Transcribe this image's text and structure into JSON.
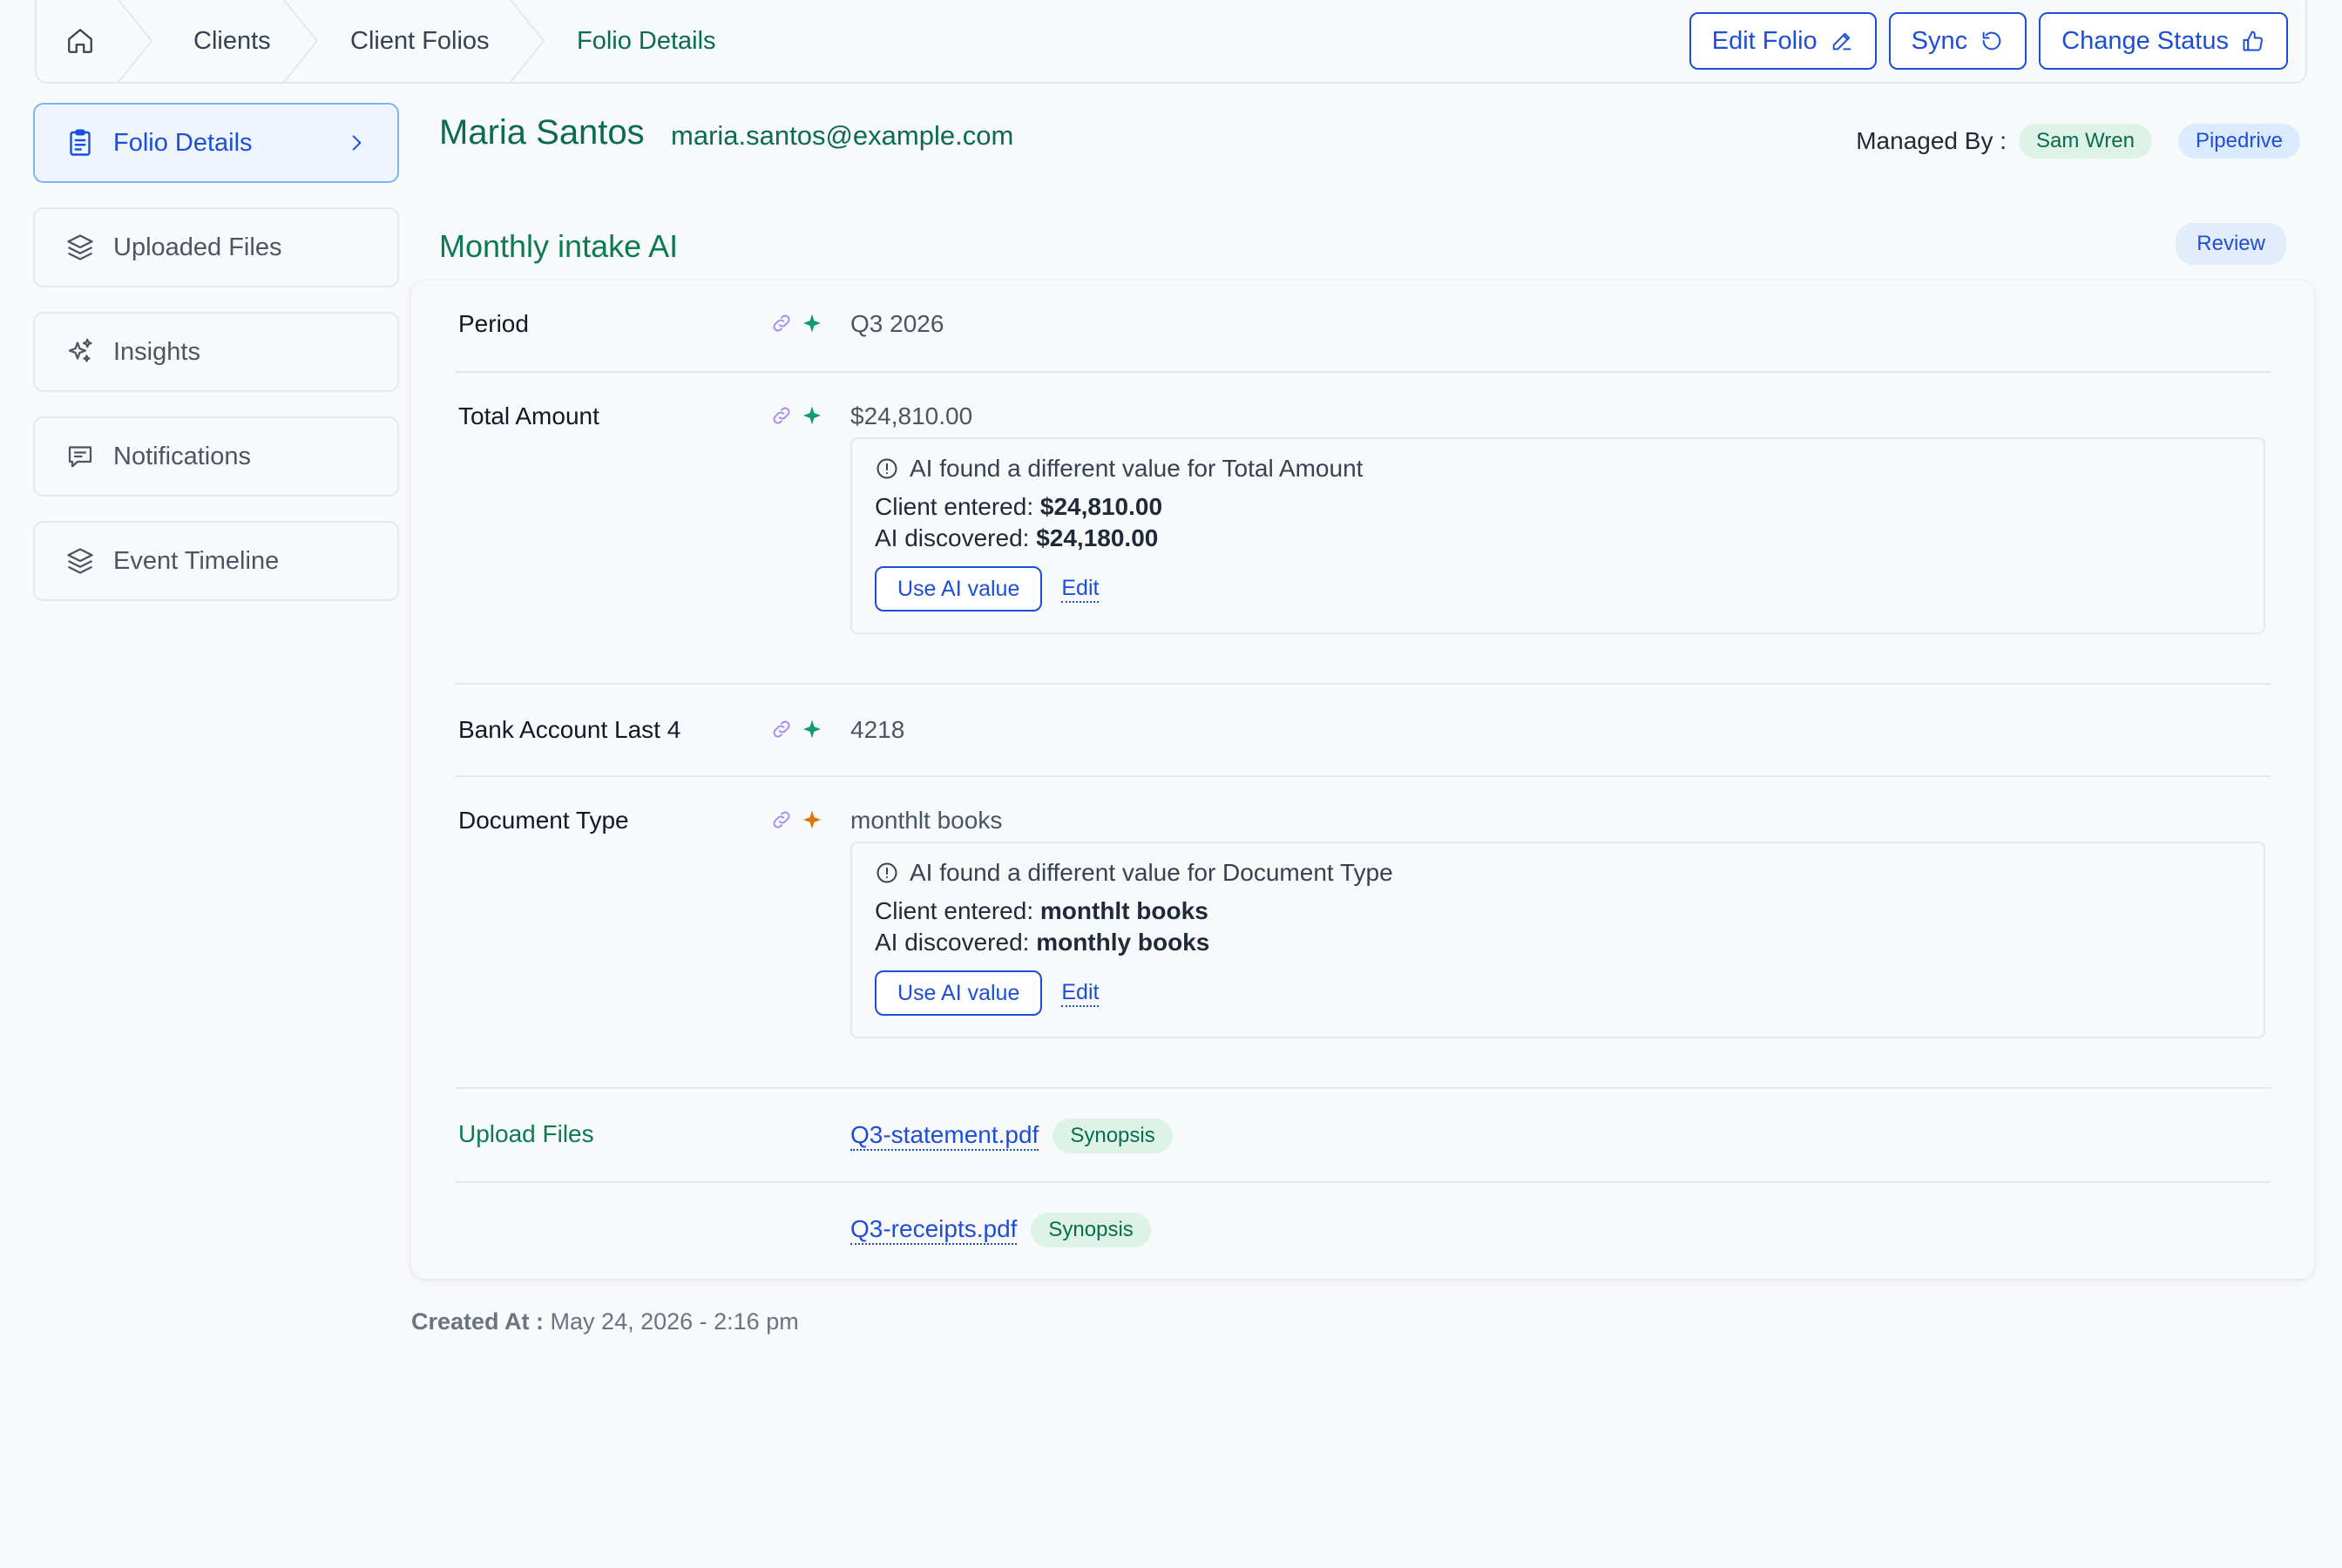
{
  "breadcrumb": {
    "home_icon": "home-icon",
    "items": [
      "Clients",
      "Client Folios",
      "Folio Details"
    ]
  },
  "toolbar": {
    "edit_folio": "Edit Folio",
    "sync": "Sync",
    "change_status": "Change Status"
  },
  "sidebar": {
    "items": [
      {
        "label": "Folio Details",
        "icon": "clipboard-icon",
        "active": true
      },
      {
        "label": "Uploaded Files",
        "icon": "layers-icon"
      },
      {
        "label": "Insights",
        "icon": "sparkles-icon"
      },
      {
        "label": "Notifications",
        "icon": "message-icon"
      },
      {
        "label": "Event Timeline",
        "icon": "layers-icon"
      }
    ]
  },
  "client": {
    "name": "Maria Santos",
    "email": "maria.santos@example.com",
    "managed_by_label": "Managed By :",
    "manager": "Sam Wren",
    "source": "Pipedrive"
  },
  "section": {
    "title": "Monthly intake AI",
    "status": "Review"
  },
  "fields": [
    {
      "label": "Period",
      "value": "Q3 2026",
      "sparkle_color": "#0f9d6b"
    },
    {
      "label": "Total Amount",
      "value": "$24,810.00",
      "sparkle_color": "#0f9d6b",
      "ai": {
        "heading": "AI found a different value for Total Amount",
        "client_label": "Client entered:",
        "client_value": "$24,810.00",
        "ai_label": "AI discovered:",
        "ai_value": "$24,180.00",
        "use_button": "Use AI value",
        "edit_link": "Edit"
      }
    },
    {
      "label": "Bank Account Last 4",
      "value": "4218",
      "sparkle_color": "#0f9d6b"
    },
    {
      "label": "Document Type",
      "value": "monthlt books",
      "sparkle_color": "#d97706",
      "ai": {
        "heading": "AI found a different value for Document Type",
        "client_label": "Client entered:",
        "client_value": "monthlt books",
        "ai_label": "AI discovered:",
        "ai_value": "monthly books",
        "use_button": "Use AI value",
        "edit_link": "Edit"
      }
    }
  ],
  "uploads": {
    "label": "Upload Files",
    "files": [
      {
        "name": "Q3-statement.pdf",
        "tag": "Synopsis"
      },
      {
        "name": "Q3-receipts.pdf",
        "tag": "Synopsis"
      }
    ]
  },
  "created": {
    "label": "Created At :",
    "value": "May 24, 2026 - 2:16 pm"
  },
  "colors": {
    "brand_green": "#0b6b4f",
    "brand_blue": "#1d4ed8",
    "link_icon": "#a78bfa"
  }
}
